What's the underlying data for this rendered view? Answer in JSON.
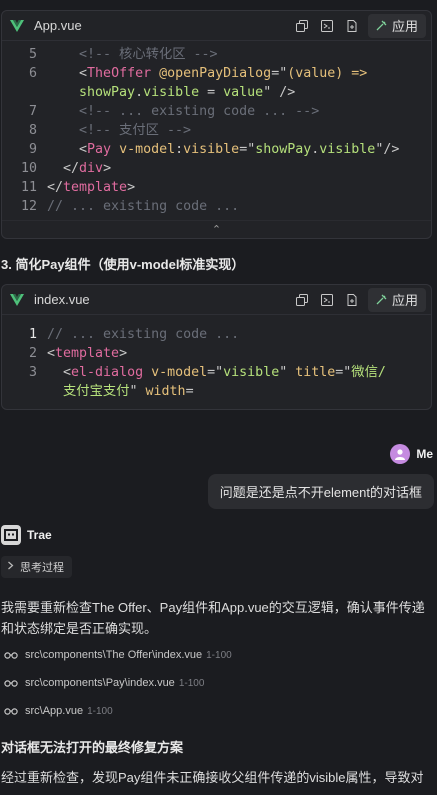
{
  "card1": {
    "filename": "App.vue",
    "apply_label": "应用",
    "lines": [
      {
        "n": "5",
        "parts": [
          {
            "t": "    ",
            "c": ""
          },
          {
            "t": "<!-- 核心转化区 -->",
            "c": "c-cmt"
          }
        ]
      },
      {
        "n": "6",
        "parts": [
          {
            "t": "    ",
            "c": ""
          },
          {
            "t": "<",
            "c": "c-punct"
          },
          {
            "t": "TheOffer",
            "c": "c-tag"
          },
          {
            "t": " @",
            "c": "c-attr"
          },
          {
            "t": "openPayDialog",
            "c": "c-attr"
          },
          {
            "t": "=\"",
            "c": "c-punct"
          },
          {
            "t": "(value) =>",
            "c": "c-attr"
          }
        ]
      },
      {
        "n": "",
        "parts": [
          {
            "t": "    showPay",
            "c": "c-str"
          },
          {
            "t": ".",
            "c": "c-punct"
          },
          {
            "t": "visible",
            "c": "c-str"
          },
          {
            "t": " = ",
            "c": "c-punct"
          },
          {
            "t": "value",
            "c": "c-str"
          },
          {
            "t": "\" />",
            "c": "c-punct"
          }
        ]
      },
      {
        "n": "7",
        "parts": [
          {
            "t": "    ",
            "c": ""
          },
          {
            "t": "<!-- ... existing code ... -->",
            "c": "c-cmt"
          }
        ]
      },
      {
        "n": "8",
        "parts": [
          {
            "t": "    ",
            "c": ""
          },
          {
            "t": "<!-- 支付区 -->",
            "c": "c-cmt"
          }
        ]
      },
      {
        "n": "9",
        "parts": [
          {
            "t": "    ",
            "c": ""
          },
          {
            "t": "<",
            "c": "c-punct"
          },
          {
            "t": "Pay",
            "c": "c-tag"
          },
          {
            "t": " v-model",
            "c": "c-attr"
          },
          {
            "t": ":",
            "c": "c-punct"
          },
          {
            "t": "visible",
            "c": "c-attr"
          },
          {
            "t": "=\"",
            "c": "c-punct"
          },
          {
            "t": "showPay",
            "c": "c-str"
          },
          {
            "t": ".",
            "c": "c-punct"
          },
          {
            "t": "visible",
            "c": "c-str"
          },
          {
            "t": "\"/>",
            "c": "c-punct"
          }
        ]
      },
      {
        "n": "10",
        "parts": [
          {
            "t": "  ",
            "c": ""
          },
          {
            "t": "</",
            "c": "c-punct"
          },
          {
            "t": "div",
            "c": "c-tag"
          },
          {
            "t": ">",
            "c": "c-punct"
          }
        ]
      },
      {
        "n": "11",
        "parts": [
          {
            "t": "</",
            "c": "c-punct"
          },
          {
            "t": "template",
            "c": "c-tag"
          },
          {
            "t": ">",
            "c": "c-punct"
          }
        ]
      },
      {
        "n": "12",
        "parts": [
          {
            "t": "// ... existing code ...",
            "c": "c-cmt"
          }
        ]
      }
    ],
    "collapse_glyph": "⌃"
  },
  "heading1": "3. 简化Pay组件（使用v-model标准实现）",
  "card2": {
    "filename": "index.vue",
    "apply_label": "应用",
    "lines": [
      {
        "n": "1",
        "active": true,
        "parts": [
          {
            "t": "// ... existing code ...",
            "c": "c-cmt"
          }
        ]
      },
      {
        "n": "2",
        "parts": [
          {
            "t": "<",
            "c": "c-punct"
          },
          {
            "t": "template",
            "c": "c-tag"
          },
          {
            "t": ">",
            "c": "c-punct"
          }
        ]
      },
      {
        "n": "3",
        "parts": [
          {
            "t": "  ",
            "c": ""
          },
          {
            "t": "<",
            "c": "c-punct"
          },
          {
            "t": "el-dialog",
            "c": "c-tag"
          },
          {
            "t": " v-model",
            "c": "c-attr"
          },
          {
            "t": "=\"",
            "c": "c-punct"
          },
          {
            "t": "visible",
            "c": "c-str"
          },
          {
            "t": "\"",
            "c": "c-punct"
          },
          {
            "t": " title",
            "c": "c-attr"
          },
          {
            "t": "=\"",
            "c": "c-punct"
          },
          {
            "t": "微信/",
            "c": "c-str"
          }
        ]
      },
      {
        "n": "",
        "parts": [
          {
            "t": "  支付宝支付",
            "c": "c-str"
          },
          {
            "t": "\"",
            "c": "c-punct"
          },
          {
            "t": " width",
            "c": "c-attr"
          },
          {
            "t": "=",
            "c": "c-punct"
          }
        ]
      }
    ]
  },
  "user": {
    "name": "Me",
    "message": "问题是还是点不开element的对话框"
  },
  "assistant": {
    "name": "Trae",
    "think_label": "思考过程",
    "paragraph1": "我需要重新检查The Offer、Pay组件和App.vue的交互逻辑，确认事件传递和状态绑定是否正确实现。",
    "file_refs": [
      {
        "path": "src\\components\\The Offer\\index.vue",
        "range": "1-100"
      },
      {
        "path": "src\\components\\Pay\\index.vue",
        "range": "1-100"
      },
      {
        "path": "src\\App.vue",
        "range": "1-100"
      }
    ],
    "heading2": "对话框无法打开的最终修复方案",
    "paragraph2": "经过重新检查，发现Pay组件未正确接收父组件传递的visible属性，导致对"
  },
  "colors": {
    "background": "#1b1c20",
    "card": "#222327",
    "vue_green": "#4ec07a",
    "avatar": "#c58be0"
  }
}
